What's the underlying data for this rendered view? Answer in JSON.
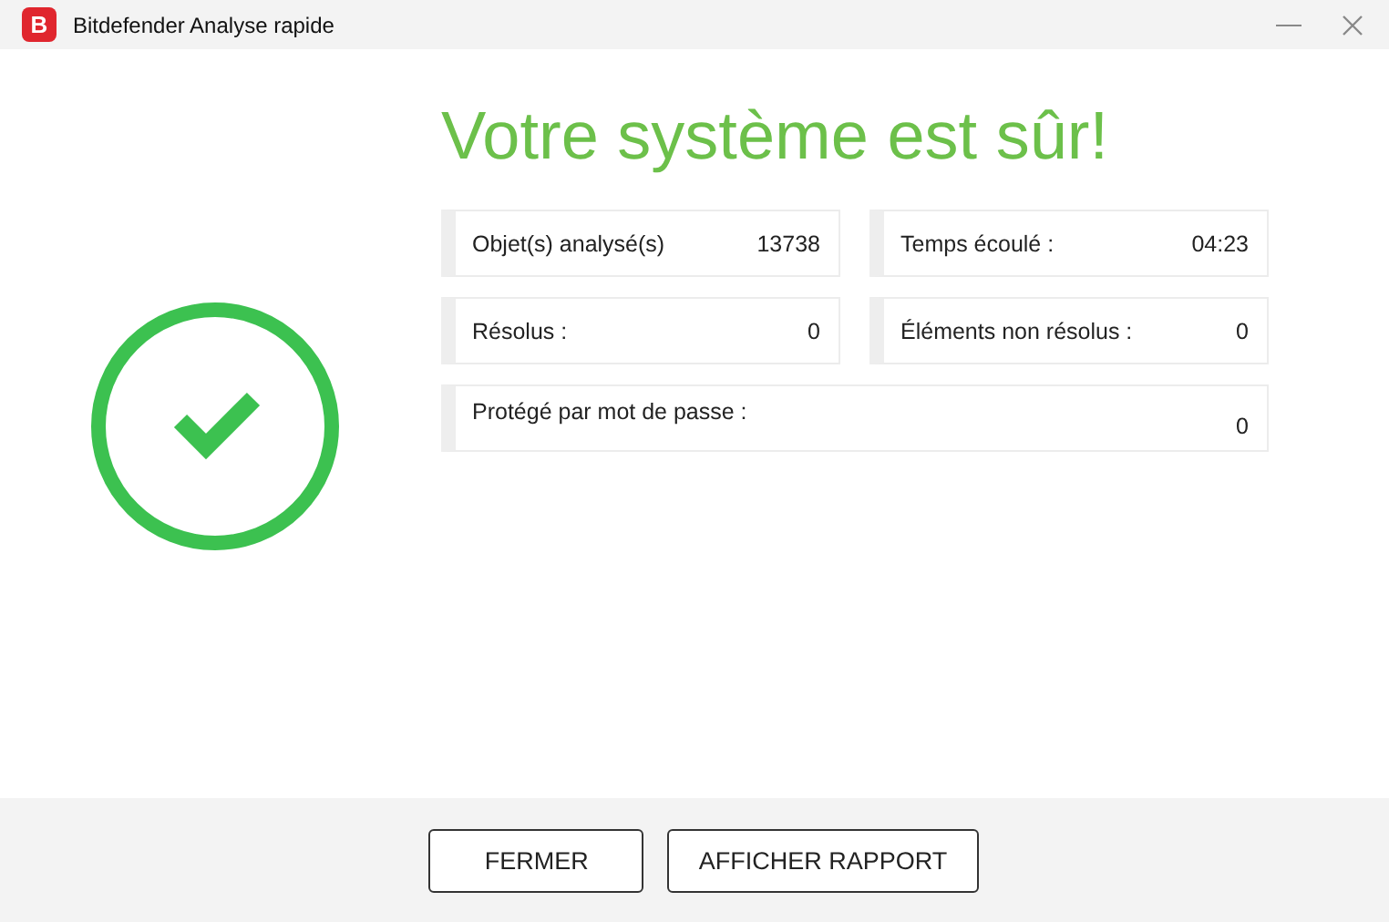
{
  "window": {
    "title": "Bitdefender Analyse rapide",
    "logo": "B"
  },
  "status": {
    "kind": "safe",
    "heading": "Votre système est sûr!"
  },
  "stats": [
    {
      "label": "Objet(s) analysé(s)",
      "value": "13738",
      "kind": "half"
    },
    {
      "label": "Temps écoulé :",
      "value": "04:23",
      "kind": "half"
    },
    {
      "label": "Résolus :",
      "value": "0",
      "kind": "half"
    },
    {
      "label": "Éléments non résolus :",
      "value": "0",
      "kind": "half"
    },
    {
      "label": "Protégé par mot de passe :",
      "value": "0",
      "kind": "full"
    }
  ],
  "buttons": [
    "FERMER",
    "AFFICHER RAPPORT"
  ]
}
